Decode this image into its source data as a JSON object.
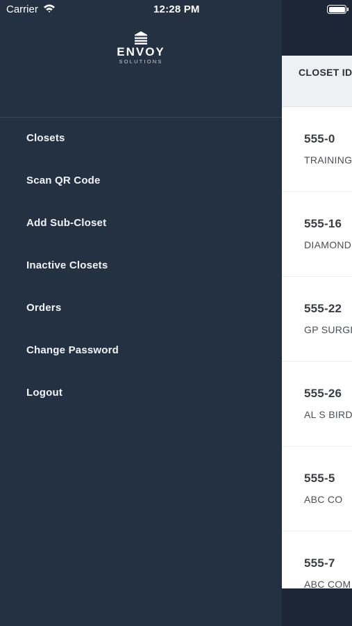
{
  "status_bar": {
    "carrier": "Carrier",
    "time": "12:28 PM",
    "wifi_icon": "wifi-icon",
    "battery_icon": "battery-icon"
  },
  "drawer": {
    "logo": {
      "word": "ENVOY",
      "sub": "SOLUTIONS",
      "icon": "building-logo-icon"
    },
    "menu": [
      {
        "label": "Closets"
      },
      {
        "label": "Scan QR Code"
      },
      {
        "label": "Add Sub-Closet"
      },
      {
        "label": "Inactive Closets"
      },
      {
        "label": "Orders"
      },
      {
        "label": "Change Password"
      },
      {
        "label": "Logout"
      }
    ]
  },
  "closet_list": {
    "column_header": "CLOSET ID",
    "rows": [
      {
        "id": "555-0",
        "name": "TRAINING"
      },
      {
        "id": "555-16",
        "name": "DIAMOND"
      },
      {
        "id": "555-22",
        "name": "GP SURGE"
      },
      {
        "id": "555-26",
        "name": "AL S BIRD"
      },
      {
        "id": "555-5",
        "name": "ABC CO"
      },
      {
        "id": "555-7",
        "name": "ABC COM"
      }
    ]
  },
  "colors": {
    "drawer_bg": "#243142",
    "header_bg": "#1c2637",
    "list_bg": "#ffffff",
    "text_light": "#f2f4f7"
  }
}
